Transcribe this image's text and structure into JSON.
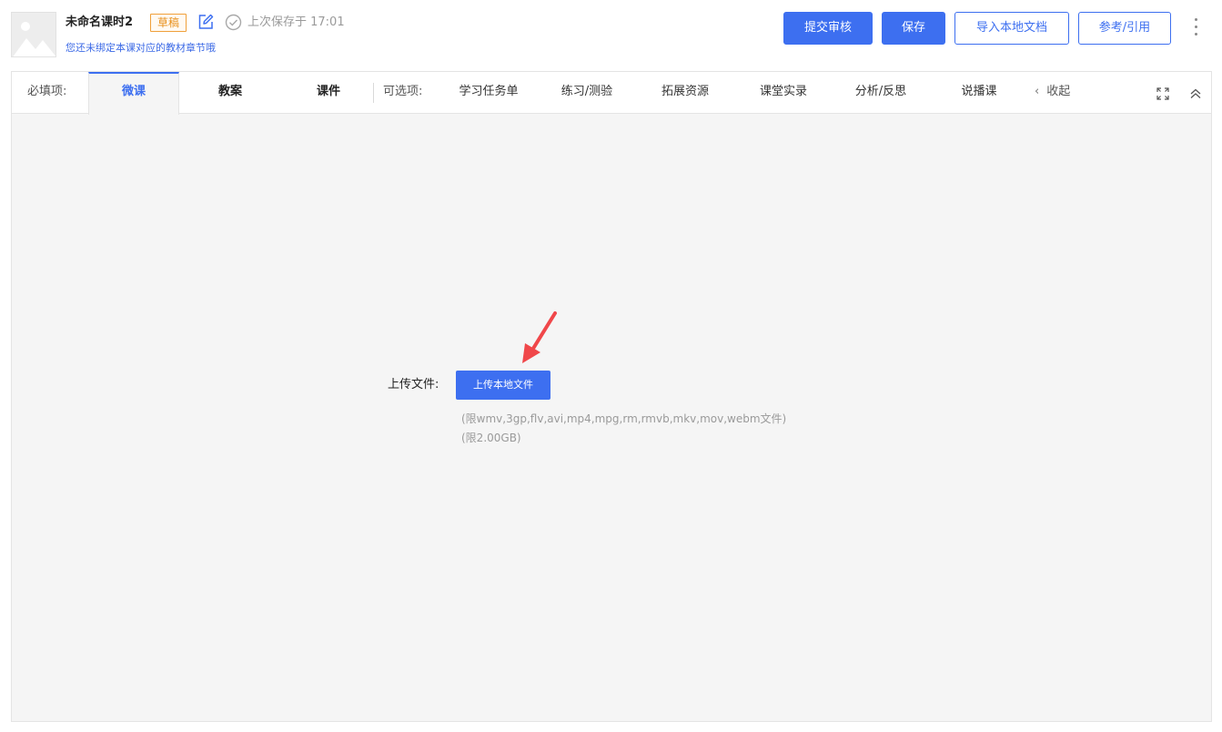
{
  "header": {
    "title": "未命名课时2",
    "status_badge": "草稿",
    "save_status": "上次保存于 17:01",
    "bind_hint": "您还未绑定本课对应的教材章节哦",
    "buttons": {
      "submit": "提交审核",
      "save": "保存",
      "import": "导入本地文档",
      "reference": "参考/引用"
    }
  },
  "tabs": {
    "required_label": "必填项:",
    "required": [
      {
        "label": "微课"
      },
      {
        "label": "教案"
      },
      {
        "label": "课件"
      }
    ],
    "optional_label": "可选项:",
    "optional": [
      {
        "label": "学习任务单"
      },
      {
        "label": "练习/测验"
      },
      {
        "label": "拓展资源"
      },
      {
        "label": "课堂实录"
      },
      {
        "label": "分析/反思"
      },
      {
        "label": "说播课"
      }
    ],
    "collapse_label": "收起"
  },
  "upload": {
    "label": "上传文件:",
    "button": "上传本地文件",
    "formats_hint": "(限wmv,3gp,flv,avi,mp4,mpg,rm,rmvb,mkv,mov,webm文件)",
    "size_hint": "(限2.00GB)"
  },
  "colors": {
    "primary": "#3d6ff0",
    "badge": "#e8901c",
    "arrow": "#f0474a"
  }
}
